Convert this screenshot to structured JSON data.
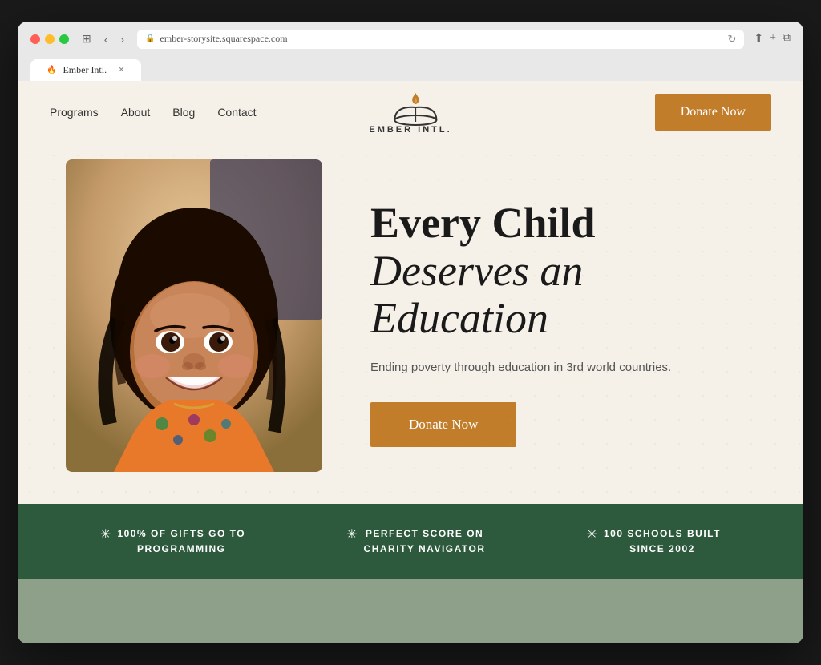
{
  "browser": {
    "url": "ember-storysite.squarespace.com",
    "tab_title": "Ember Intl."
  },
  "nav": {
    "links": [
      "Programs",
      "About",
      "Blog",
      "Contact"
    ],
    "logo_name": "EMBER INTL.",
    "donate_button": "Donate Now"
  },
  "hero": {
    "title_line1": "Every Child",
    "title_line2": "Deserves an",
    "title_line3": "Education",
    "subtitle": "Ending poverty through education in 3rd world countries.",
    "donate_button": "Donate Now"
  },
  "stats": [
    {
      "star": "✳",
      "line1": "100% OF GIFTS GO TO",
      "line2": "PROGRAMMING"
    },
    {
      "star": "✳",
      "line1": "PERFECT SCORE ON",
      "line2": "CHARITY NAVIGATOR"
    },
    {
      "star": "✳",
      "line1": "100 SCHOOLS BUILT",
      "line2": "SINCE 2002"
    }
  ],
  "colors": {
    "donate_button": "#c17d2a",
    "stats_bar": "#2d5a3d",
    "background": "#f5f0e8"
  }
}
